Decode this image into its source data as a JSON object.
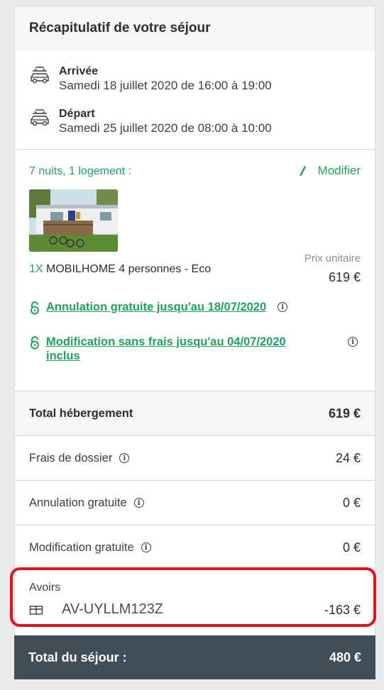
{
  "header": {
    "title": "Récapitulatif de votre séjour"
  },
  "arrival": {
    "title": "Arrivée",
    "detail": "Samedi 18 juillet 2020 de 16:00 à 19:00",
    "icon": "car-icon"
  },
  "departure": {
    "title": "Départ",
    "detail": "Samedi 25 juillet 2020 de 08:00 à 10:00",
    "icon": "car-icon"
  },
  "stay": {
    "summary": "7 nuits, 1 logement :",
    "modify_label": "Modifier",
    "product_qty": "1X",
    "product_name": "MOBILHOME 4 personnes - Eco",
    "unit_label": "Prix unitaire",
    "unit_price": "619 €",
    "cancellation_link": "Annulation gratuite jusqu'au 18/07/2020",
    "modification_link_line1": "Modification sans frais jusqu'au 04/07/2020",
    "modification_link_line2": "inclus"
  },
  "totals": {
    "accommodation_label": "Total hébergement",
    "accommodation_amount": "619 €",
    "fees_label": "Frais de dossier",
    "fees_amount": "24 €",
    "cancellation_label": "Annulation gratuite",
    "cancellation_amount": "0 €",
    "modification_label": "Modification gratuite",
    "modification_amount": "0 €"
  },
  "avoirs": {
    "title": "Avoirs",
    "code": "AV-UYLLM123Z",
    "amount": "-163 €"
  },
  "grand_total": {
    "label": "Total du séjour :",
    "amount": "480 €"
  },
  "colors": {
    "accent": "#1da35e",
    "total_bar": "#414d57",
    "highlight": "#e3121b"
  }
}
